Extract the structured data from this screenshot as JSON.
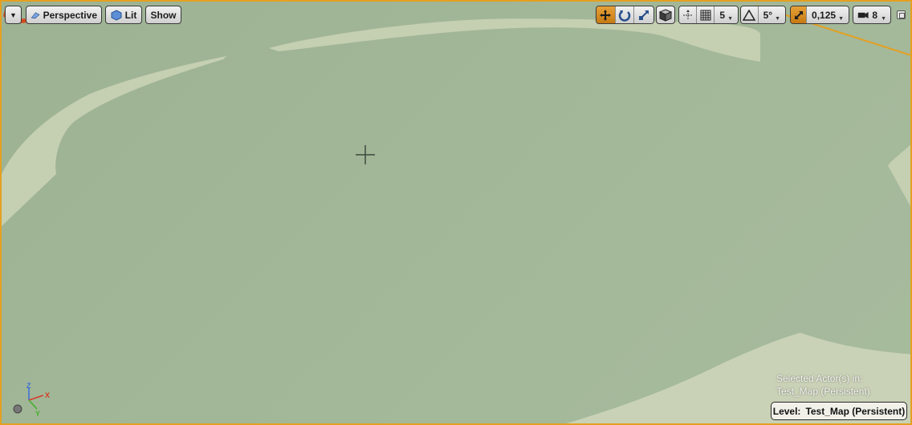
{
  "toolbar": {
    "menu_icon": "dropdown-arrow-icon",
    "perspective_label": "Perspective",
    "lit_label": "Lit",
    "show_label": "Show",
    "grid_snap_value": "5",
    "rotation_snap_value": "5°",
    "scale_snap_value": "0,125",
    "camera_speed_value": "8"
  },
  "info": {
    "selected_line1": "Selected Actor(s) in:",
    "selected_line2": "Test_Map (Persistent)",
    "level_prefix": "Level:",
    "level_name": "Test_Map (Persistent)"
  },
  "axis": {
    "x": "X",
    "y": "Y",
    "z": "Z"
  },
  "colors": {
    "ground": "#a2b798",
    "path": "#c5cfb2",
    "selection_border": "#e4a021",
    "accent_orange": "#d98a1c"
  }
}
